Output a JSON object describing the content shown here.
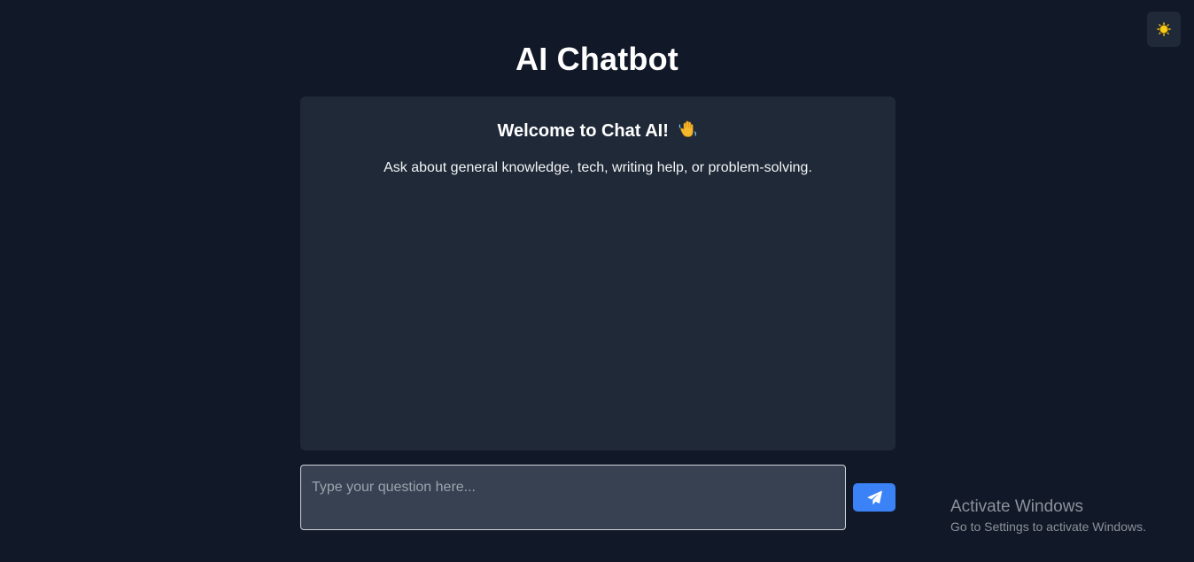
{
  "app": {
    "title": "AI Chatbot"
  },
  "theme_toggle": {
    "icon": "sun-icon",
    "color": "#facc15"
  },
  "chat": {
    "welcome_heading": "Welcome to Chat AI!",
    "welcome_icon": "waving-hand-icon",
    "welcome_text": "Ask about general knowledge, tech, writing help, or problem-solving."
  },
  "composer": {
    "placeholder": "Type your question here...",
    "value": "",
    "send_icon": "paper-plane-icon",
    "send_color": "#3b82f6"
  },
  "watermark": {
    "title": "Activate Windows",
    "subtitle": "Go to Settings to activate Windows."
  },
  "colors": {
    "background": "#111827",
    "panel": "#1f2937",
    "input": "#374151"
  }
}
